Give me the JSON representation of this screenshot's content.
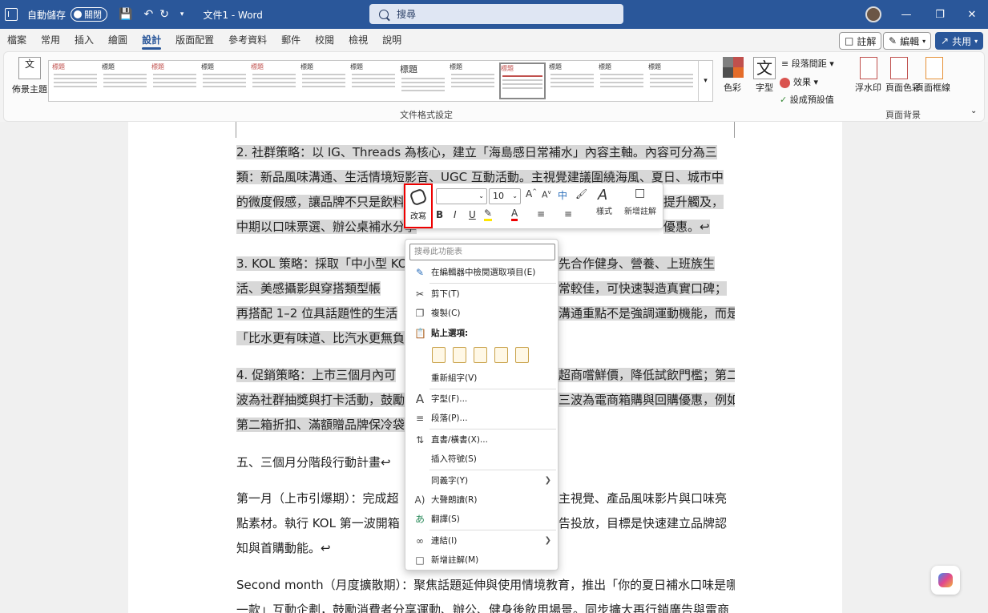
{
  "titlebar": {
    "autosave_label": "自動儲存",
    "autosave_state": "關閉",
    "doc_title": "文件1 - Word",
    "search_placeholder": "搜尋"
  },
  "tabs": [
    "檔案",
    "常用",
    "插入",
    "繪圖",
    "設計",
    "版面配置",
    "參考資料",
    "郵件",
    "校閱",
    "檢視",
    "說明"
  ],
  "active_tab": "設計",
  "tab_right": {
    "comment": "註解",
    "edit": "編輯",
    "share": "共用"
  },
  "ribbon": {
    "theme_label": "佈景主題",
    "gallery_caption": "文件格式設定",
    "thumb_title": "標題",
    "thumb_subtitle": "標題 1",
    "colors_label": "色彩",
    "fonts_label": "字型",
    "para_spacing": "段落間距",
    "effects": "效果",
    "set_default": "設成預設值",
    "watermark": "浮水印",
    "page_color": "頁面色彩",
    "page_borders": "頁面框線",
    "page_bg_caption": "頁面背景"
  },
  "document": {
    "p2": [
      "2. 社群策略：以 IG、Threads 為核心，建立「海島感日常補水」內容主軸。內容可分為三",
      "類：新品風味溝通、生活情境短影音、UGC 互動活動。主視覺建議圍繞海風、夏日、城市中",
      "的微度假感，讓品牌不只是飲料，",
      "中期以口味票選、辦公桌補水分享"
    ],
    "p2_right": [
      "提升觸及，",
      "優惠。↩"
    ],
    "p3": [
      "3. KOL 策略：採取「中小型 KO",
      "活、美感攝影與穿搭類型帳",
      "再搭配 1–2 位具話題性的生活",
      "「比水更有味道、比汽水更無負"
    ],
    "p3_right": [
      "先合作健身、營養、上班族生",
      "常較佳，可快速製造真實口碑；",
      "溝通重點不是強調運動機能，而是"
    ],
    "p4": [
      "4. 促銷策略：上市三個月內可",
      "波為社群抽獎與打卡活動，鼓勵",
      "第二箱折扣、滿額贈品牌保冷袋"
    ],
    "p4_right": [
      "超商嚐鮮價，降低試飲門檻；第二",
      "三波為電商箱購與回購優惠，例如"
    ],
    "heading5": "五、三個月分階段行動計畫↩",
    "month1": [
      "第一月（上市引爆期）：完成超",
      "點素材。執行 KOL 第一波開箱",
      "知與首購動能。↩"
    ],
    "month1_right": [
      "主視覺、產品風味影片與口味亮",
      "告投放，目標是快速建立品牌認"
    ],
    "month2": [
      "Second month（月度擴散期）：聚焦話題延伸與使用情境教育，推出「你的夏日補水口味是哪",
      "一款」互動企劃，鼓勵消費者分享運動、辦公、健身後飲用場景。同步擴大再行銷廣告與電商"
    ]
  },
  "minitoolbar": {
    "rewrite": "改寫",
    "font_size": "10",
    "styles": "樣式",
    "new_comment": "新增註解"
  },
  "context_menu": {
    "search_placeholder": "搜尋此功能表",
    "items": [
      {
        "label": "在編輯器中檢閱選取項目(E)",
        "icon": "editor-icon"
      },
      {
        "label": "剪下(T)",
        "icon": "scissors-icon"
      },
      {
        "label": "複製(C)",
        "icon": "copy-icon"
      },
      {
        "label": "貼上選項:",
        "icon": "paste-icon"
      },
      {
        "label": "重新組字(V)",
        "icon": ""
      },
      {
        "label": "字型(F)...",
        "icon": "font-icon"
      },
      {
        "label": "段落(P)...",
        "icon": "paragraph-icon"
      },
      {
        "label": "直書/橫書(X)...",
        "icon": "text-direction-icon"
      },
      {
        "label": "插入符號(S)",
        "icon": ""
      },
      {
        "label": "同義字(Y)",
        "icon": ""
      },
      {
        "label": "大聲朗讀(R)",
        "icon": "read-aloud-icon"
      },
      {
        "label": "翻譯(S)",
        "icon": "translate-icon"
      },
      {
        "label": "連結(I)",
        "icon": "link-icon"
      },
      {
        "label": "新增註解(M)",
        "icon": "comment-icon"
      }
    ]
  },
  "colors": {
    "accent": "#2a579a",
    "highlight": "#d8d8d8",
    "rewrite_border": "#e00000"
  }
}
